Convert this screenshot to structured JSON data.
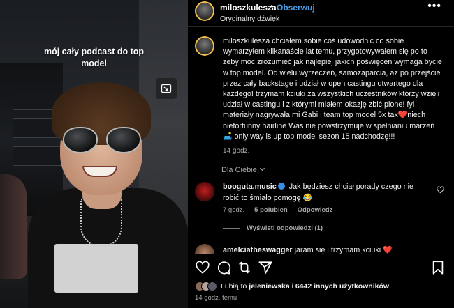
{
  "video": {
    "caption_overlay": "mój cały podcast do top model",
    "pip_icon": "picture-in-picture-icon"
  },
  "header": {
    "username": "miloszkulesza",
    "separator": "•",
    "follow_label": "Obserwuj",
    "audio_label": "Oryginalny dźwięk",
    "more_icon": "more-horizontal-icon"
  },
  "caption": {
    "username": "miloszkulesza",
    "text_before_emoji1": " chciałem sobie coś udowodnić co sobie wymarzyłem kilkanaście lat temu, przygotowywałem się po to żeby móc zrozumieć jak najlepiej jakich poświęceń wymaga bycie w top model. Od wielu wyrzeczeń, samozaparcia, aż po przejście przez cały backstage i udział w open castingu otwartego dla każdego! trzymam kciuki za wszystkich uczestników którzy wzięli udział w castingu i z którymi miałem okazję zbić pione! fyi materiały nagrywała mi Gabi i team top model 5x tak",
    "emoji1": "❤️",
    "text_mid": "niech niefortunny hairline Was nie powstrzymuje w spełnianiu marzeń ",
    "emoji2": "🛋️",
    "text_after": " only way is up top model sezon 15 nadchodzę!!!",
    "time": "14 godz."
  },
  "for_you": {
    "label": "Dla Ciebie",
    "chevron_icon": "chevron-down-icon"
  },
  "comment": {
    "username": "booguta.music",
    "text": " Jak będziesz chciał porady czego nie robić to śmiało pomogę ",
    "emoji": "😂",
    "time": "7 godz.",
    "likes": "5 polubień",
    "reply": "Odpowiedz",
    "view_replies": "Wyświetl odpowiedzi (1)"
  },
  "comment2": {
    "username": "amelciatheswagger",
    "text": " jaram się i trzymam kciuki ",
    "emoji": "❤️"
  },
  "actions": {
    "like_icon": "heart-icon",
    "comment_icon": "comment-icon",
    "repost_icon": "repost-icon",
    "share_icon": "send-icon",
    "save_icon": "bookmark-icon"
  },
  "likes": {
    "prefix": "Lubią to ",
    "user": "jeleniewska",
    "middle": " i ",
    "count": "6442 innych użytkowników"
  },
  "post_time": "14 godz. temu",
  "colors": {
    "background": "#000000",
    "link_blue": "#4a9ee8",
    "muted": "#a8a8a8",
    "verified": "#3a8ee6"
  }
}
